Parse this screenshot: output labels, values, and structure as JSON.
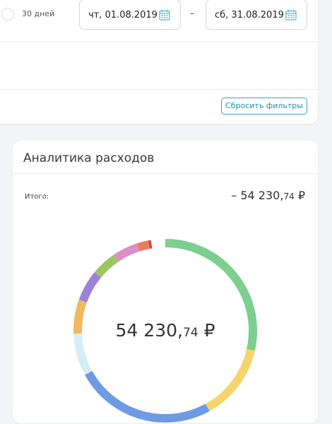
{
  "filters": {
    "period_option_label": "30 дней",
    "date_from": "чт, 01.08.2019",
    "date_separator": "–",
    "date_to": "сб, 31.08.2019",
    "reset_button_label": "Сбросить фильтры"
  },
  "analytics": {
    "title": "Аналитика расходов",
    "total_label": "Итого:",
    "total_sign": "– ",
    "total_integer": "54 230,",
    "total_fraction": "74",
    "currency": "₽",
    "center_integer": "54 230,",
    "center_fraction": "74",
    "center_currency": "₽"
  },
  "chart_data": {
    "type": "pie",
    "title": "",
    "total": "54 230,74 ₽",
    "series": [
      {
        "color": "#7ccf8f",
        "share": 0.285
      },
      {
        "color": "#f5d56b",
        "share": 0.135
      },
      {
        "color": "#6e9be3",
        "share": 0.25
      },
      {
        "color": "#d5eef4",
        "share": 0.075
      },
      {
        "color": "#f0b95b",
        "share": 0.06
      },
      {
        "color": "#9a82d8",
        "share": 0.055
      },
      {
        "color": "#9dc563",
        "share": 0.045
      },
      {
        "color": "#dc8fc5",
        "share": 0.045
      },
      {
        "color": "#ee7c5c",
        "share": 0.02
      },
      {
        "color": "#c94f4a",
        "share": 0.005
      }
    ],
    "start_angle_deg": 0
  },
  "icons": {
    "calendar": "calendar-icon",
    "radio": "radio-unchecked-icon"
  },
  "colors": {
    "accent": "#1e93b0",
    "calendar_icon": "#4fb3cf"
  }
}
